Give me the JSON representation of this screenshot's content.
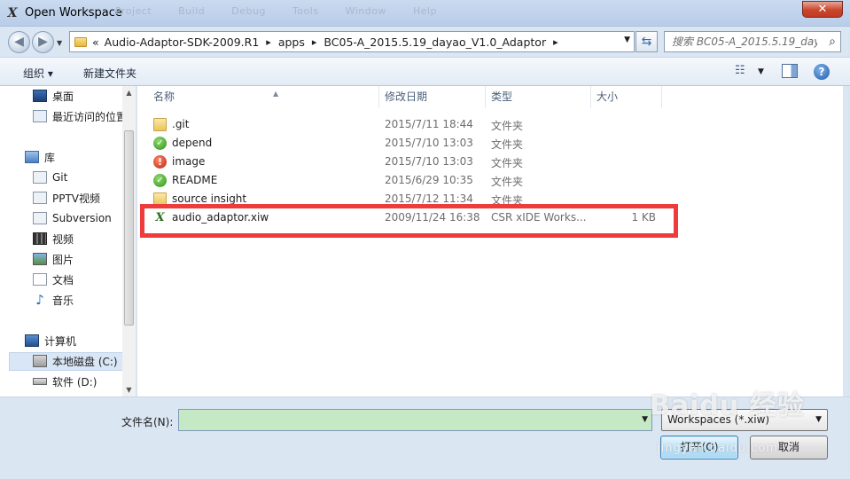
{
  "window": {
    "title": "Open Workspace",
    "app_icon_glyph": "X",
    "close_glyph": "✕"
  },
  "background_menu": [
    "Project",
    "Build",
    "Debug",
    "Tools",
    "Window",
    "Help"
  ],
  "address": {
    "overflow": "«",
    "crumbs": [
      "Audio-Adaptor-SDK-2009.R1",
      "apps",
      "BC05-A_2015.5.19_dayao_V1.0_Adaptor"
    ],
    "separator": "▸",
    "search_placeholder": "搜索 BC05-A_2015.5.19_day..."
  },
  "toolbar": {
    "organize": "组织 ▾",
    "new_folder": "新建文件夹"
  },
  "navpane": {
    "items": [
      {
        "label": "桌面",
        "icon": "desktop-icon"
      },
      {
        "label": "最近访问的位置",
        "icon": "recent-places-icon"
      },
      {
        "label": "库",
        "icon": "libraries-icon"
      },
      {
        "label": "Git",
        "icon": "git-library-icon"
      },
      {
        "label": "PPTV视频",
        "icon": "video-library-icon"
      },
      {
        "label": "Subversion",
        "icon": "svn-library-icon"
      },
      {
        "label": "视频",
        "icon": "videos-icon"
      },
      {
        "label": "图片",
        "icon": "pictures-icon"
      },
      {
        "label": "文档",
        "icon": "documents-icon"
      },
      {
        "label": "音乐",
        "icon": "music-icon"
      },
      {
        "label": "计算机",
        "icon": "computer-icon"
      },
      {
        "label": "本地磁盘 (C:)",
        "icon": "local-disk-icon"
      },
      {
        "label": "软件 (D:)",
        "icon": "drive-icon"
      }
    ],
    "selected": "本地磁盘 (C:)"
  },
  "columns": {
    "name": "名称",
    "modified": "修改日期",
    "type": "类型",
    "size": "大小"
  },
  "files": [
    {
      "name": ".git",
      "modified": "2015/7/11 18:44",
      "type": "文件夹",
      "size": "",
      "icon": "folder-icon"
    },
    {
      "name": "depend",
      "modified": "2015/7/10 13:03",
      "type": "文件夹",
      "size": "",
      "icon": "folder-svn-ok-icon"
    },
    {
      "name": "image",
      "modified": "2015/7/10 13:03",
      "type": "文件夹",
      "size": "",
      "icon": "folder-svn-conflict-icon"
    },
    {
      "name": "README",
      "modified": "2015/6/29 10:35",
      "type": "文件夹",
      "size": "",
      "icon": "folder-svn-ok-icon"
    },
    {
      "name": "source insight",
      "modified": "2015/7/12 11:34",
      "type": "文件夹",
      "size": "",
      "icon": "folder-icon"
    },
    {
      "name": "audio_adaptor.xiw",
      "modified": "2009/11/24 16:38",
      "type": "CSR xIDE Works...",
      "size": "1 KB",
      "icon": "xide-workspace-file-icon"
    }
  ],
  "bottom": {
    "filename_label": "文件名(N):",
    "filename_value": "",
    "filetype": "Workspaces (*.xiw)",
    "open_button": "打开(O)",
    "cancel_button": "取消"
  },
  "watermark": {
    "logo": "Baidu 经验",
    "url": "jingyan.baidu.com"
  },
  "colors": {
    "highlight_box": "#ee3b3b",
    "filename_field_bg": "#c5e8c5",
    "window_chrome": "#dbe6f3"
  }
}
